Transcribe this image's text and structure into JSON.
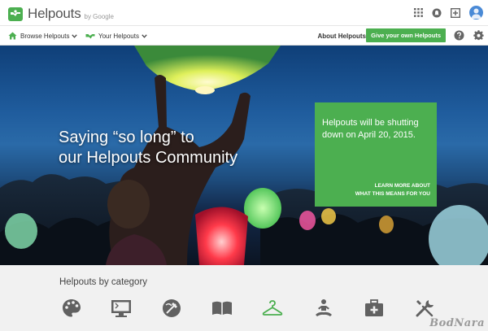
{
  "app": {
    "name": "Helpouts",
    "by": "by Google"
  },
  "topbar": {
    "icons": [
      "apps-grid-icon",
      "notifications-icon",
      "add-icon",
      "avatar"
    ]
  },
  "nav": {
    "browse_label": "Browse Helpouts",
    "your_label": "Your Helpouts",
    "about_label": "About Helpouts",
    "give_label": "Give your own Helpouts"
  },
  "hero": {
    "headline_line1": "Saying “so long” to",
    "headline_line2": "our Helpouts Community",
    "notice_text": "Helpouts will be shutting down on April 20, 2015.",
    "notice_link_line1": "LEARN MORE ABOUT",
    "notice_link_line2": "WHAT THIS MEANS FOR YOU"
  },
  "category": {
    "title": "Helpouts by category",
    "items": [
      "art-palette-icon",
      "computers-icon",
      "cooking-icon",
      "education-book-icon",
      "fashion-hanger-icon",
      "fitness-yoga-icon",
      "health-kit-icon",
      "home-tools-icon"
    ]
  },
  "colors": {
    "brand_green": "#4caf50",
    "avatar_blue": "#4a8ad6",
    "icon_gray": "#616161"
  },
  "watermark": "BodNara"
}
